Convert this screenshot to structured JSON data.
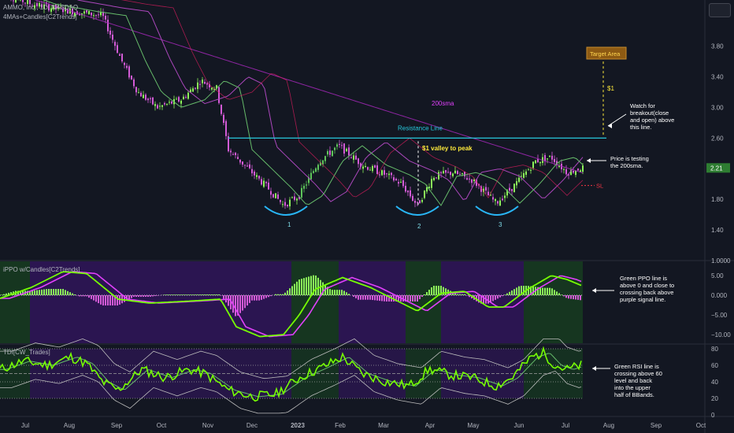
{
  "header": {
    "title": "AMMO, Inc., 1D, NASDAQ",
    "indicator": "4MAs+Candles[C2Trends]"
  },
  "panes": {
    "ppo_title": "iPPO w/Candles[C2Trends]",
    "tdi_title": "TDI[CW_Trades]"
  },
  "colors": {
    "background": "#131722",
    "bull": "#8cf35a",
    "bear": "#d35bd6",
    "resistance": "#26c6da",
    "sma200": "#c2185b",
    "target_bg": "#8d5a13",
    "target_text": "#ffd54f",
    "annotation_yellow": "#ffeb3b",
    "sl": "#f23645"
  },
  "price_axis_labels": [
    "3.80",
    "3.40",
    "3.00",
    "2.60",
    "2.20",
    "1.80",
    "1.40",
    "1.0000"
  ],
  "last_price": "2.21",
  "ppo_axis_labels": [
    "5.00",
    "0.000",
    "−5.00",
    "−10.00"
  ],
  "tdi_axis_labels": [
    "80",
    "60",
    "40",
    "20",
    "0"
  ],
  "time_axis_labels": [
    "Jul",
    "Aug",
    "Sep",
    "Oct",
    "Nov",
    "Dec",
    "2023",
    "Feb",
    "Mar",
    "Apr",
    "May",
    "Jun",
    "Jul",
    "Aug",
    "Sep",
    "Oct"
  ],
  "annotations": {
    "target_area": "Target Area",
    "dollar_one": "$1",
    "sma200": "200sma",
    "resistance": "Resistance Line",
    "valley_to_peak": "$1 valley to peak",
    "sl": "SL",
    "cup_labels": [
      "1",
      "2",
      "3"
    ],
    "watch_lines": [
      "Watch for",
      "breakout(close",
      "and open) above",
      "this line."
    ],
    "testing_lines": [
      "Price is testing",
      "the 200sma."
    ],
    "ppo_note_lines": [
      "Green PPO line is",
      "above 0 and close to",
      "crossing back above",
      "purple signal line."
    ],
    "rsi_note_lines": [
      "Green RSI line is",
      "crossing above 60",
      "level and back",
      "into the upper",
      "half of BBands."
    ]
  },
  "chart_data": {
    "type": "line",
    "title": "AMMO, Inc., 1D, NASDAQ",
    "x_labels": [
      "Jul",
      "Aug",
      "Sep",
      "Oct",
      "Nov",
      "Dec",
      "2023",
      "Feb",
      "Mar",
      "Apr",
      "May",
      "Jun",
      "Jul",
      "Aug",
      "Sep",
      "Oct"
    ],
    "price_ylim": [
      1.0,
      4.3
    ],
    "resistance_level": 2.6,
    "sl_level": 1.98,
    "target_level": 3.6,
    "last_price": 2.21,
    "series": [
      {
        "name": "price",
        "x": [
          "Sep",
          "Oct",
          "Nov",
          "Dec",
          "2023",
          "Feb",
          "Mar",
          "Apr",
          "May",
          "Jun",
          "Jul"
        ],
        "values": [
          3.8,
          3.1,
          3.2,
          2.1,
          1.75,
          2.5,
          2.0,
          2.1,
          1.75,
          2.4,
          2.21
        ]
      },
      {
        "name": "200sma",
        "x": [
          "Jul",
          "Sep",
          "Nov",
          "Jan",
          "Mar",
          "May",
          "Jul"
        ],
        "values": [
          4.5,
          4.1,
          3.6,
          3.15,
          2.8,
          2.45,
          2.2
        ]
      }
    ],
    "ppo_ylim": [
      -12,
      8
    ],
    "tdi_ylim": [
      0,
      90
    ],
    "tdi_levels": [
      80,
      60,
      50,
      40,
      20
    ]
  }
}
